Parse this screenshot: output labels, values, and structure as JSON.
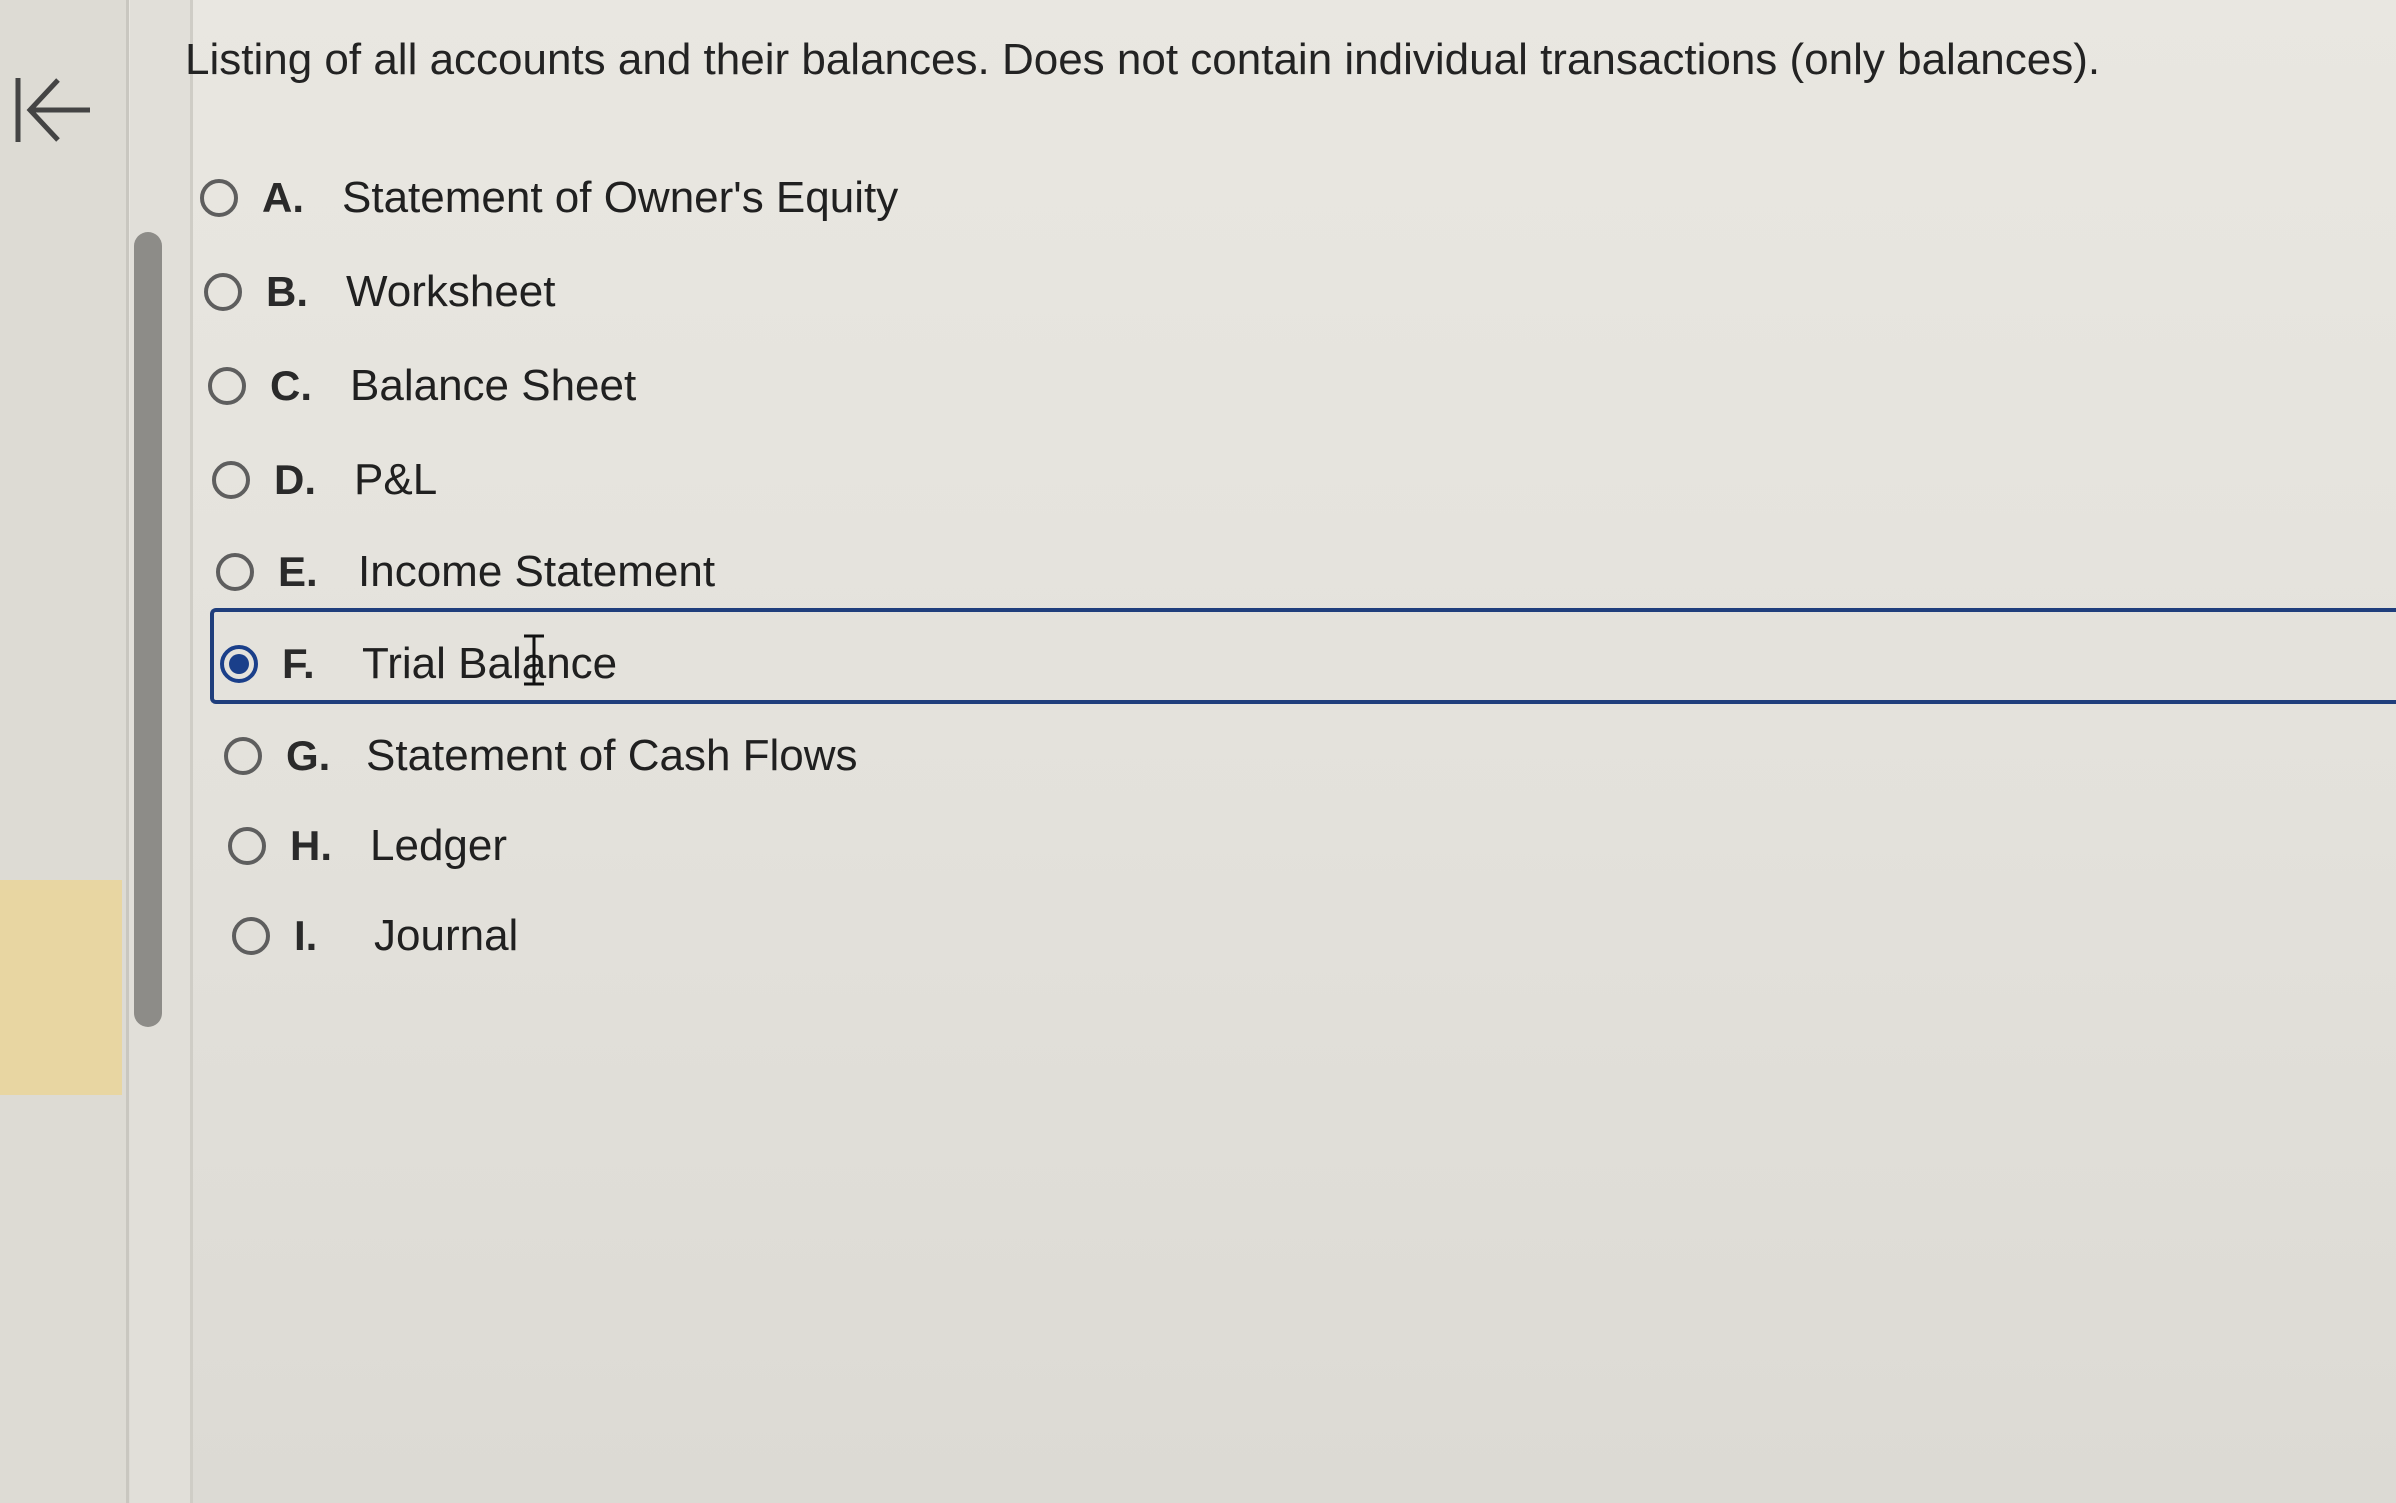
{
  "question": "Listing of all accounts and their balances. Does not contain individual transactions (only balances).",
  "options": [
    {
      "letter": "A.",
      "label": "Statement of Owner's Equity",
      "selected": false
    },
    {
      "letter": "B.",
      "label": "Worksheet",
      "selected": false
    },
    {
      "letter": "C.",
      "label": "Balance Sheet",
      "selected": false
    },
    {
      "letter": "D.",
      "label": "P&L",
      "selected": false
    },
    {
      "letter": "E.",
      "label": "Income Statement",
      "selected": false
    },
    {
      "letter": "F.",
      "label": "Trial Balance",
      "selected": true
    },
    {
      "letter": "G.",
      "label": "Statement of Cash Flows",
      "selected": false
    },
    {
      "letter": "H.",
      "label": "Ledger",
      "selected": false
    },
    {
      "letter": "I.",
      "label": "Journal",
      "selected": false
    }
  ],
  "icons": {
    "collapse": "collapse-left-arrow-icon",
    "cursor": "text-cursor-icon"
  },
  "colors": {
    "accent": "#1a3f8a",
    "highlight": "#e8d6a2"
  }
}
